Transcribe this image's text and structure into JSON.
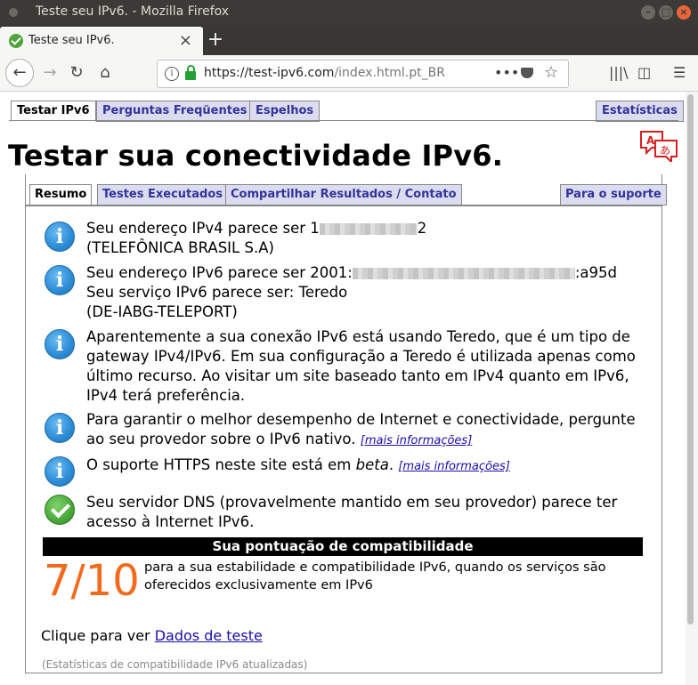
{
  "window": {
    "title": "Teste seu IPv6. - Mozilla Firefox"
  },
  "browser": {
    "tab_title": "Teste seu IPv6.",
    "url_host": "https://test-ipv6.com",
    "url_path": "/index.html.pt_BR"
  },
  "top_tabs": [
    "Testar IPv6",
    "Perguntas Freqüentes",
    "Espelhos",
    "Estatísticas"
  ],
  "heading": "Testar sua conectividade IPv6.",
  "inner_tabs": [
    "Resumo",
    "Testes Executados",
    "Compartilhar Resultados / Contato",
    "Para o suporte"
  ],
  "messages": {
    "ipv4_prefix": "Seu endereço IPv4 parece ser 1",
    "ipv4_suffix": "2",
    "ipv4_isp": "(TELEFÔNICA BRASIL S.A)",
    "ipv6_prefix": "Seu endereço IPv6 parece ser 2001:",
    "ipv6_suffix": ":a95d",
    "ipv6_service": "Seu serviço IPv6 parece ser: Teredo",
    "ipv6_provider": "(DE-IABG-TELEPORT)",
    "teredo": "Aparentemente a sua conexão IPv6 está usando Teredo, que é um tipo de gateway IPv4/IPv6. Em sua configuração a Teredo é utilizada apenas como último recurso. Ao visitar um site baseado tanto em IPv4 quanto em IPv6, IPv4 terá preferência.",
    "native": "Para garantir o melhor desempenho de Internet e conectividade, pergunte ao seu provedor sobre o IPv6 nativo.",
    "https_prefix": "O suporte HTTPS neste site está em ",
    "https_beta": "beta",
    "https_suffix": ".",
    "dns": "Seu servidor DNS (provavelmente mantido em seu provedor) parece ter acesso à Internet IPv6.",
    "more_info": "[mais informações]"
  },
  "score": {
    "header": "Sua pontuação de compatibilidade",
    "value": "7/10",
    "description": "para a sua estabilidade e compatibilidade IPv6, quando os serviços são oferecidos exclusivamente em IPv6"
  },
  "footer": {
    "click_text": "Clique para ver ",
    "click_link": "Dados de teste",
    "updated": "(Estatísticas de compatibilidade IPv6 atualizadas)"
  },
  "icons": {
    "info": "info-icon",
    "ok": "checkmark-icon",
    "translate": "translate-icon"
  },
  "colors": {
    "score": "#f26b1d",
    "tab_inactive_bg": "#dcdcf0",
    "tab_inactive_text": "#33339a",
    "link": "#1a0dab"
  }
}
